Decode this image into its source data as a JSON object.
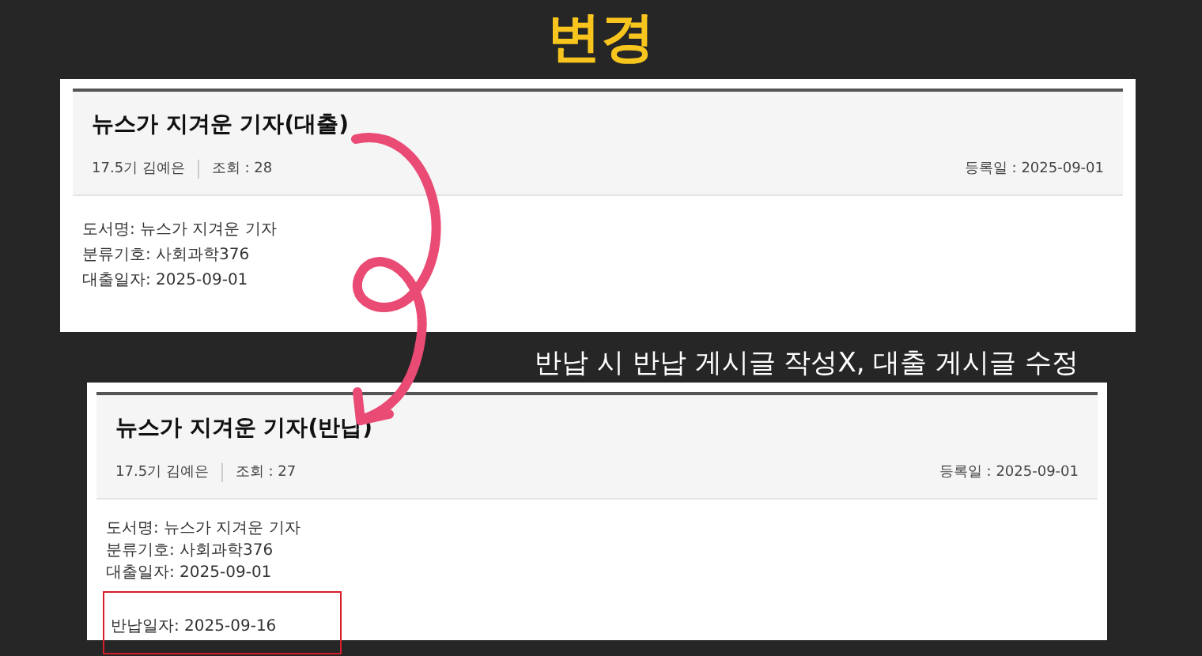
{
  "slide_title": "변경",
  "posts": [
    {
      "title": "뉴스가 지겨운 기자(대출)",
      "author": "17.5기 김예은",
      "views": "조회 : 28",
      "date": "등록일 : 2025-09-01",
      "body": [
        {
          "text": "도서명: 뉴스가 지겨운 기자",
          "highlighted": false
        },
        {
          "text": "분류기호: 사회과학376",
          "highlighted": false
        },
        {
          "text": "대출일자: 2025-09-01",
          "highlighted": false
        }
      ]
    },
    {
      "title": "뉴스가 지겨운 기자(반납)",
      "author": "17.5기 김예은",
      "views": "조회 : 27",
      "date": "등록일 : 2025-09-01",
      "body": [
        {
          "text": "도서명: 뉴스가 지겨운 기자",
          "highlighted": false
        },
        {
          "text": "분류기호: 사회과학376",
          "highlighted": false
        },
        {
          "text": "대출일자: 2025-09-01",
          "highlighted": false
        },
        {
          "text": "반납일자: 2025-09-16",
          "highlighted": true
        }
      ]
    }
  ],
  "caption": "반납 시 반납 게시글 작성X, 대출 게시글 수정"
}
